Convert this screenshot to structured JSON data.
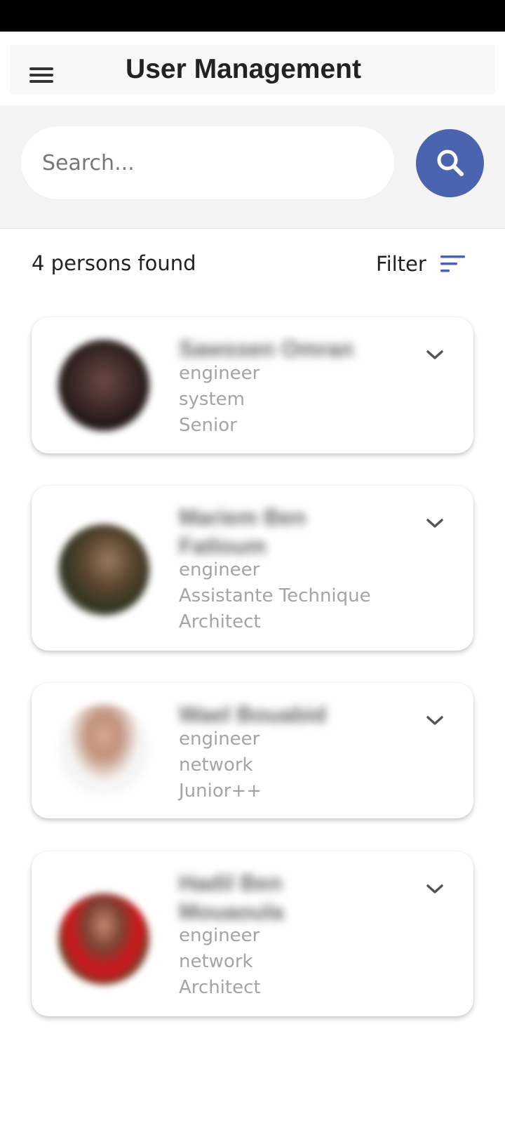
{
  "header": {
    "title": "User Management",
    "menu_icon": "hamburger-menu-icon"
  },
  "search": {
    "placeholder": "Search...",
    "button_icon": "search-icon",
    "button_color": "#4a64b0"
  },
  "results": {
    "count_text": "4 persons found",
    "filter_label": "Filter",
    "filter_icon": "sort-lines-icon",
    "accent_color": "#4a64b0"
  },
  "persons": [
    {
      "name": "Sawssen Omran",
      "role": "engineer",
      "department": "system",
      "level": "Senior"
    },
    {
      "name": "Mariem Ben Fatloum",
      "role": "engineer",
      "department": "Assistante Technique",
      "level": "Architect"
    },
    {
      "name": "Wael Bouabid",
      "role": "engineer",
      "department": "network",
      "level": "Junior++"
    },
    {
      "name": "Hadil Ben Mouaoula",
      "role": "engineer",
      "department": "network",
      "level": "Architect"
    }
  ]
}
